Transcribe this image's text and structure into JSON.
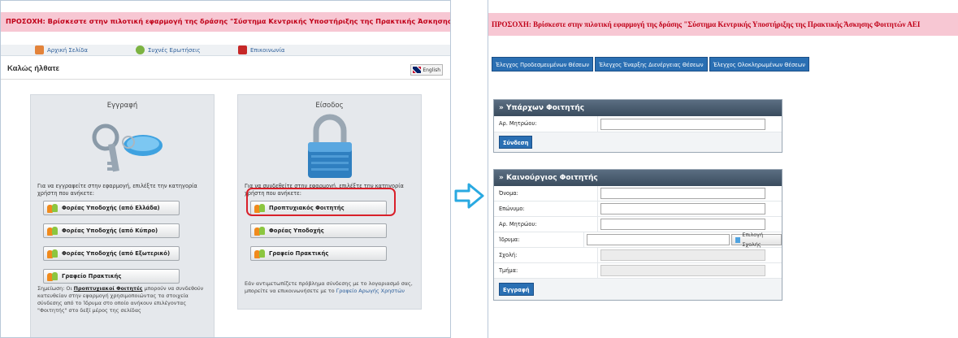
{
  "left": {
    "warning": "ΠΡΟΣΟΧΗ: Βρίσκεστε στην πιλοτική εφαρμογή της δράσης \"Σύστημα Κεντρικής Υποστήριξης της Πρακτικής Άσκησης Φοιτητών ΑΕΙ\"",
    "nav": {
      "home": "Αρχική Σελίδα",
      "faq": "Συχνές Ερωτήσεις",
      "contact": "Επικοινωνία"
    },
    "welcome": "Καλώς ήλθατε",
    "english": "English",
    "registration": {
      "title": "Εγγραφή",
      "desc": "Για να εγγραφείτε στην εφαρμογή, επιλέξτε την κατηγορία χρήστη που ανήκετε:",
      "buttons": [
        "Φορέας Υποδοχής (από Ελλάδα)",
        "Φορέας Υποδοχής (από Κύπρο)",
        "Φορέας Υποδοχής (από Εξωτερικό)",
        "Γραφείο Πρακτικής"
      ],
      "note_prefix": "Σημείωση: Οι",
      "note_emph": "Προπτυχιακοί Φοιτητές",
      "note_suffix": "μπορούν να συνδεθούν κατευθείαν στην εφαρμογή χρησιμοποιώντας τα στοιχεία σύνδεσης από το Ίδρυμα στο οποίο ανήκουν επιλέγοντας \"Φοιτητής\" στο δεξί μέρος της σελίδας"
    },
    "login": {
      "title": "Είσοδος",
      "desc": "Για να συνδεθείτε στην εφαρμογή, επιλέξτε την κατηγορία χρήστη που ανήκετε:",
      "buttons": [
        "Προπτυχιακός Φοιτητής",
        "Φορέας Υποδοχής",
        "Γραφείο Πρακτικής"
      ],
      "help": "Εάν αντιμετωπίζετε πρόβλημα σύνδεσης με το λογαριασμό σας, μπορείτε να επικοινωνήσετε με το",
      "help_link": "Γραφείο Αρωγής Χρηστών"
    }
  },
  "right": {
    "warning": "ΠΡΟΣΟΧΗ: Βρίσκεστε στην πιλοτική εφαρμογή της δράσης \"Σύστημα Κεντρικής Υποστήριξης της Πρακτικής Άσκησης Φοιτητών ΑΕΙ",
    "tabs": [
      "Έλεγχος Προδεσμευμένων Θέσεων",
      "Έλεγχος Έναρξης Διενέργειας Θέσεων",
      "Έλεγχος Ολοκληρωμένων Θέσεων"
    ],
    "existing": {
      "title": "» Υπάρχων Φοιτητής",
      "am_label": "Αρ. Μητρώου:",
      "submit": "Σύνδεση"
    },
    "newstudent": {
      "title": "» Καινούργιος Φοιτητής",
      "labels": [
        "Όνομα:",
        "Επώνυμο:",
        "Αρ. Μητρώου:",
        "Ίδρυμα:",
        "Σχολή:",
        "Τμήμα:"
      ],
      "school_btn": "Επιλογή Σχολής",
      "submit": "Εγγραφή"
    }
  },
  "colors": {
    "warn_bg": "#f7c7d3",
    "warn_fg": "#c00018",
    "accent": "#2a6fb3",
    "highlight": "#d9202a",
    "arrow": "#29a9e1"
  }
}
